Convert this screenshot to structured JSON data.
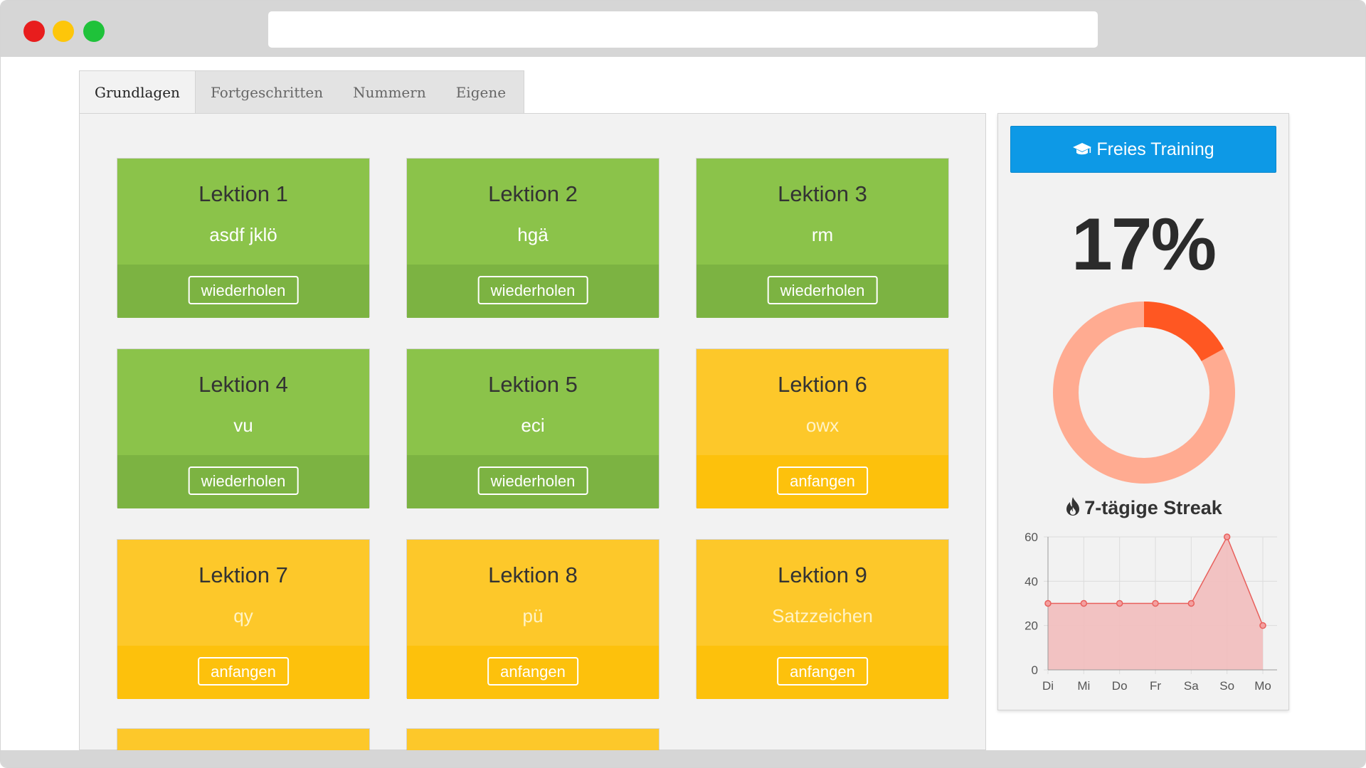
{
  "tabs": [
    {
      "label": "Grundlagen",
      "active": true
    },
    {
      "label": "Fortgeschritten",
      "active": false
    },
    {
      "label": "Nummern",
      "active": false
    },
    {
      "label": "Eigene",
      "active": false
    }
  ],
  "lessons": [
    {
      "title": "Lektion 1",
      "keys": "asdf jklö",
      "action": "wiederholen",
      "status": "done"
    },
    {
      "title": "Lektion 2",
      "keys": "hgä",
      "action": "wiederholen",
      "status": "done"
    },
    {
      "title": "Lektion 3",
      "keys": "rm",
      "action": "wiederholen",
      "status": "done"
    },
    {
      "title": "Lektion 4",
      "keys": "vu",
      "action": "wiederholen",
      "status": "done"
    },
    {
      "title": "Lektion 5",
      "keys": "eci",
      "action": "wiederholen",
      "status": "done"
    },
    {
      "title": "Lektion 6",
      "keys": "owx",
      "action": "anfangen",
      "status": "open"
    },
    {
      "title": "Lektion 7",
      "keys": "qy",
      "action": "anfangen",
      "status": "open"
    },
    {
      "title": "Lektion 8",
      "keys": "pü",
      "action": "anfangen",
      "status": "open"
    },
    {
      "title": "Lektion 9",
      "keys": "Satzzeichen",
      "action": "anfangen",
      "status": "open"
    }
  ],
  "colors": {
    "done_top": "#8bc34a",
    "done_bottom": "#7cb342",
    "open_top": "#fdc82a",
    "open_bottom": "#fdc10c",
    "primary_button": "#0d99e6",
    "progress_done": "#ff5722",
    "progress_rest": "#ffab91",
    "streak_fill": "#f2bcbc",
    "streak_line": "#e8605c"
  },
  "sidebar": {
    "train_button_label": "Freies Training",
    "train_button_icon": "graduation-cap-icon",
    "progress_label": "17%",
    "streak_icon": "fire-icon",
    "streak_label": "7-tägige Streak"
  },
  "chart_data": {
    "type": "area",
    "categories": [
      "Di",
      "Mi",
      "Do",
      "Fr",
      "Sa",
      "So",
      "Mo"
    ],
    "values": [
      30,
      30,
      30,
      30,
      30,
      60,
      20
    ],
    "ylim": [
      0,
      60
    ],
    "yticks": [
      0,
      20,
      40,
      60
    ],
    "grid": true,
    "title": "",
    "xlabel": "",
    "ylabel": ""
  },
  "progress_chart": {
    "type": "pie",
    "values": [
      17,
      83
    ]
  }
}
